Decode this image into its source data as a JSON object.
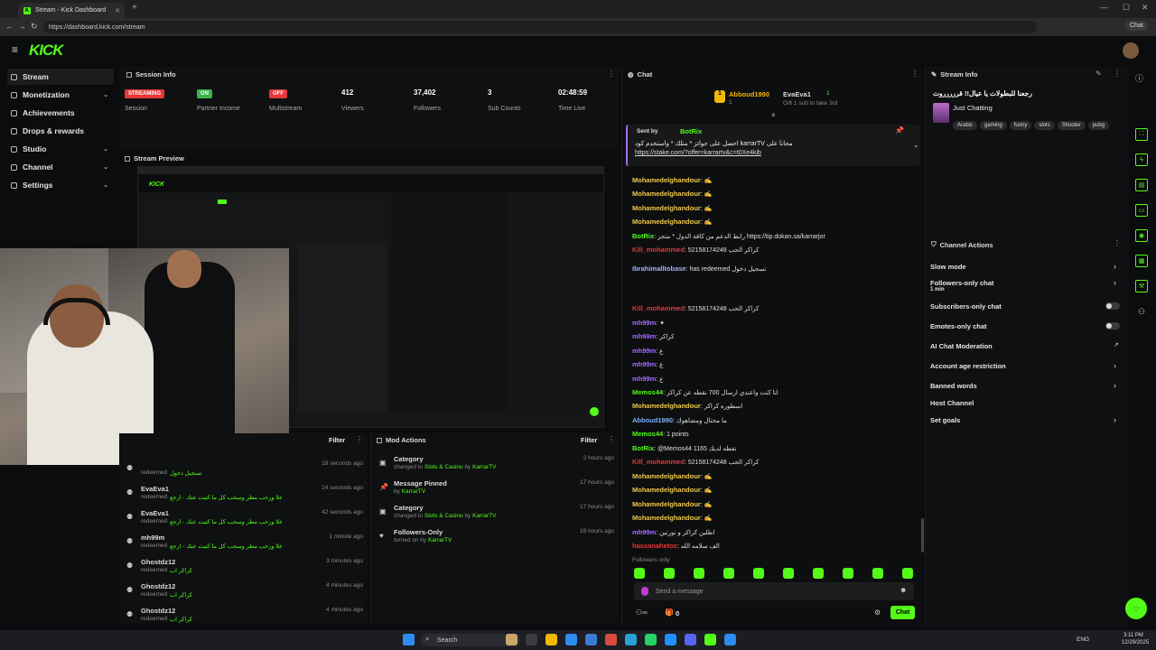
{
  "browser": {
    "tab_title": "Stream - Kick Dashboard",
    "url": "https://dashboard.kick.com/stream",
    "chat_label": "Chat"
  },
  "brand": {
    "logo": "KICK",
    "accent": "#53fc18"
  },
  "sidebar": {
    "items": [
      {
        "label": "Stream",
        "chev": ""
      },
      {
        "label": "Monetization",
        "chev": "⌄"
      },
      {
        "label": "Achievements",
        "chev": ""
      },
      {
        "label": "Drops & rewards",
        "chev": ""
      },
      {
        "label": "Studio",
        "chev": "⌄"
      },
      {
        "label": "Channel",
        "chev": "⌄"
      },
      {
        "label": "Settings",
        "chev": "⌄"
      }
    ]
  },
  "session": {
    "title": "Session Info",
    "stats": [
      {
        "value": "STREAMING",
        "label": "Session",
        "badge": "#e5383b"
      },
      {
        "value": "ON",
        "label": "Partner Income",
        "badge": "#3bb54a"
      },
      {
        "value": "OFF",
        "label": "Multistream",
        "badge": "#e5383b"
      },
      {
        "value": "412",
        "label": "Viewers"
      },
      {
        "value": "37,402",
        "label": "Followers"
      },
      {
        "value": "3",
        "label": "Sub Counts"
      },
      {
        "value": "02:48:59",
        "label": "Time Live"
      }
    ]
  },
  "preview": {
    "title": "Stream Preview"
  },
  "activity": {
    "filter": "Filter",
    "rows": [
      {
        "user": "",
        "sub": "redeemed",
        "time": "18 seconds ago",
        "msg": "تسجيل دخول"
      },
      {
        "user": "EvaEva1",
        "sub": "redeemed",
        "time": "24 seconds ago",
        "msg": "علا ورحب مطر وسحب كل ما كتبت عنك - ارجع"
      },
      {
        "user": "EvaEva1",
        "sub": "redeemed",
        "time": "42 seconds ago",
        "msg": "علا ورحب مطر وسحب كل ما كتبت عنك - ارجع"
      },
      {
        "user": "mh99m",
        "sub": "redeemed",
        "time": "1 minute ago",
        "msg": "علا ورحب مطر وسحب كل ما كتبت عنك - ارجع"
      },
      {
        "user": "Ghostdz12",
        "sub": "redeemed",
        "time": "3 minutes ago",
        "msg": "كراكر اب"
      },
      {
        "user": "Ghostdz12",
        "sub": "redeemed",
        "time": "4 minutes ago",
        "msg": "كراكر اب"
      },
      {
        "user": "Ghostdz12",
        "sub": "redeemed",
        "time": "4 minutes ago",
        "msg": "كراكر اب"
      }
    ]
  },
  "mod": {
    "title": "Mod Actions",
    "filter": "Filter",
    "rows": [
      {
        "action": "Category",
        "detail": "changed to",
        "target": "Slots & Casino",
        "by": "by",
        "who": "KarrarTV",
        "time": "2 hours ago"
      },
      {
        "action": "Message Pinned",
        "detail": "by",
        "target": "",
        "by": "",
        "who": "KarrarTV",
        "time": "17 hours ago"
      },
      {
        "action": "Category",
        "detail": "changed to",
        "target": "Slots & Casino",
        "by": "by",
        "who": "KarrarTV",
        "time": "17 hours ago"
      },
      {
        "action": "Followers-Only",
        "detail": "turned on by",
        "target": "",
        "by": "",
        "who": "KarrarTV",
        "time": "19 hours ago"
      }
    ]
  },
  "chat": {
    "title": "Chat",
    "gifter": "Abboud1990",
    "gifter_count": "1",
    "gift_user": "EvaEva1",
    "gift_count": "1",
    "gift_text": "Gift 1 sub to take 3rd",
    "pinned": {
      "sent_by": "Sent by",
      "bot": "BotRix",
      "text": "احصل على جوائز * مثلك * واستخدم كود karrarTV مجاناً على",
      "link": "https://stake.com/?offer=karrartv&c=t0Xe4kib"
    },
    "messages": [
      {
        "user": "Mohamedelghandour",
        "color": "#f2c94c",
        "text": "✍"
      },
      {
        "user": "Mohamedelghandour",
        "color": "#f2c94c",
        "text": "✍"
      },
      {
        "user": "Mohamedelghandour",
        "color": "#f2c94c",
        "text": "✍"
      },
      {
        "user": "Mohamedelghandour",
        "color": "#f2c94c",
        "text": "✍"
      },
      {
        "user": "BotRix",
        "color": "#53fc18",
        "text": "رابط الدعم من كافة الدول * متجر https://tip.dokan.sa/karrarjor"
      },
      {
        "user": "Kill_mohammed",
        "color": "#e5383b",
        "text": "52158174248 كراكر الحب"
      },
      {
        "user": "Ibrahimalltobase",
        "color": "#9fb3ff",
        "text": "has redeemed تسجيل دخول"
      },
      {
        "user": "Kill_mohammed",
        "color": "#e5383b",
        "text": "52158174248 كراكر الحب"
      },
      {
        "user": "mh99m",
        "color": "#a36bff",
        "text": "✦"
      },
      {
        "user": "mh99m",
        "color": "#a36bff",
        "text": "كراكر"
      },
      {
        "user": "mh99m",
        "color": "#a36bff",
        "text": "ع"
      },
      {
        "user": "mh99m",
        "color": "#a36bff",
        "text": "ع"
      },
      {
        "user": "mh99m",
        "color": "#a36bff",
        "text": "ع"
      },
      {
        "user": "Memos44",
        "color": "#53fc18",
        "text": "انا كنت واعندي ارسال 700 نقطه عن كراكر"
      },
      {
        "user": "Mohamedelghandour",
        "color": "#f2c94c",
        "text": "اسطوره كراكر"
      },
      {
        "user": "Abboud1990",
        "color": "#7fb0ff",
        "text": "ما محتال ومشاهوك"
      },
      {
        "user": "Memos44",
        "color": "#53fc18",
        "text": "1 points"
      },
      {
        "user": "BotRix",
        "color": "#53fc18",
        "text": "@Memos44 1165 نقطه لديك"
      },
      {
        "user": "Kill_mohammed",
        "color": "#e5383b",
        "text": "52158174248 كراكر الحب"
      },
      {
        "user": "Mohamedelghandour",
        "color": "#f2c94c",
        "text": "✍"
      },
      {
        "user": "Mohamedelghandour",
        "color": "#f2c94c",
        "text": "✍"
      },
      {
        "user": "Mohamedelghandour",
        "color": "#f2c94c",
        "text": "✍"
      },
      {
        "user": "Mohamedelghandour",
        "color": "#f2c94c",
        "text": "✍"
      },
      {
        "user": "mh99m",
        "color": "#a36bff",
        "text": "اطلبن كراكر و تورتين"
      },
      {
        "user": "hassanahetoc",
        "color": "#e5383b",
        "text": "الف سلامه الله"
      }
    ],
    "followers_only": "Followers only",
    "placeholder": "Send a message",
    "send": "Chat",
    "points": "0"
  },
  "stream_info": {
    "title": "Stream Info",
    "stream_title": "رجعنا للبطولات يا عيال!! قررررروت",
    "category": "Just Chatting",
    "tags": [
      "Arabic",
      "gaming",
      "funny",
      "slots",
      "Shooter",
      "pubg"
    ]
  },
  "channel_actions": {
    "title": "Channel Actions",
    "items": [
      {
        "label": "Slow mode",
        "sub": "",
        "ctrl": "arrow"
      },
      {
        "label": "Followers-only chat",
        "sub": "1 min",
        "ctrl": "arrow"
      },
      {
        "label": "Subscribers-only chat",
        "sub": "",
        "ctrl": "toggle"
      },
      {
        "label": "Emotes-only chat",
        "sub": "",
        "ctrl": "toggle"
      },
      {
        "label": "AI Chat Moderation",
        "sub": "",
        "ctrl": "ext"
      },
      {
        "label": "Account age restriction",
        "sub": "",
        "ctrl": "arrow"
      },
      {
        "label": "Banned words",
        "sub": "",
        "ctrl": "arrow"
      },
      {
        "label": "Host Channel",
        "sub": "",
        "ctrl": ""
      },
      {
        "label": "Set goals",
        "sub": "",
        "ctrl": "arrow"
      }
    ]
  },
  "taskbar": {
    "search": "Search",
    "lang": "ENG",
    "time": "3:11 PM",
    "date": "12/29/2025"
  }
}
